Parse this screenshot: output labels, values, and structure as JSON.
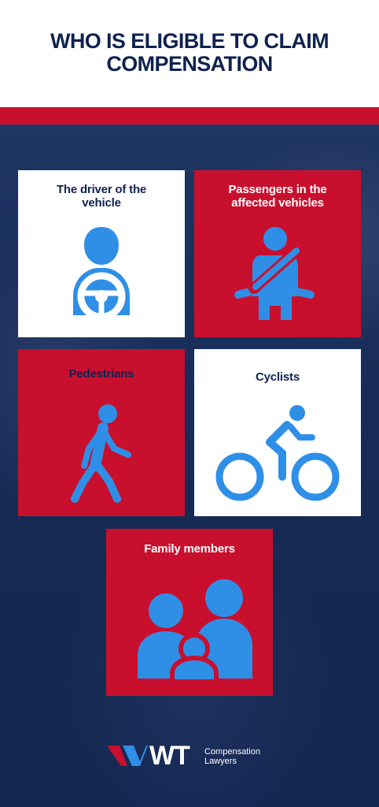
{
  "header": {
    "title_line1": "WHO IS ELIGIBLE TO CLAIM",
    "title_line2": "COMPENSATION"
  },
  "cards": [
    {
      "label_line1": "The driver of the",
      "label_line2": "vehicle",
      "icon": "driver-steering-wheel-icon"
    },
    {
      "label_line1": "Passengers in the",
      "label_line2": "affected vehicles",
      "icon": "seatbelt-passenger-icon"
    },
    {
      "label": "Pedestrians",
      "icon": "pedestrian-walking-icon"
    },
    {
      "label": "Cyclists",
      "icon": "cyclist-icon"
    },
    {
      "label": "Family members",
      "icon": "family-icon"
    }
  ],
  "colors": {
    "navy": "#0f2250",
    "red": "#c8102e",
    "icon_blue": "#2f8fe6",
    "white": "#ffffff"
  },
  "footer": {
    "logo_letters": "WT",
    "logo_line1": "Compensation",
    "logo_line2": "Lawyers"
  }
}
